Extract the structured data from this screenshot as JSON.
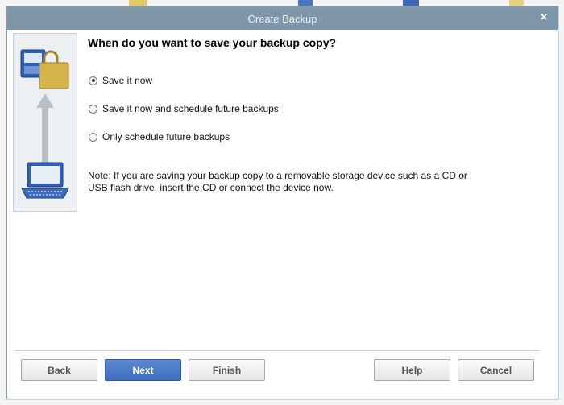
{
  "dialog": {
    "title": "Create Backup",
    "close_glyph": "×"
  },
  "question": "When do you want to save your backup copy?",
  "options": [
    {
      "label": "Save it now",
      "checked": true
    },
    {
      "label": "Save it now and schedule future backups",
      "checked": false
    },
    {
      "label": "Only schedule future backups",
      "checked": false
    }
  ],
  "note": "Note: If you are saving your backup copy to a removable storage device such as a CD or USB flash drive, insert the CD or connect the device now.",
  "buttons": {
    "back": "Back",
    "next": "Next",
    "finish": "Finish",
    "help": "Help",
    "cancel": "Cancel"
  },
  "colors": {
    "titlebar": "#7f95a8",
    "primary_button": "#4a78c5",
    "arrow": "#b9c0c6",
    "disk_blue": "#2f5fb3",
    "lock_gold": "#d4b44a"
  }
}
